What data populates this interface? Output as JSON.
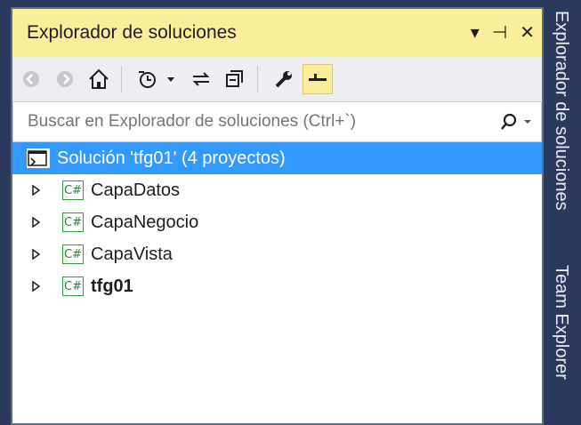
{
  "panel": {
    "title": "Explorador de soluciones",
    "window_buttons": {
      "dropdown": "▾",
      "pin": "⊣",
      "close": "✕"
    }
  },
  "toolbar": {
    "icons": [
      "back-icon",
      "forward-icon",
      "home-icon",
      "history-icon",
      "sync-icon",
      "collapse-all-icon",
      "properties-icon",
      "pin-active-icon"
    ]
  },
  "search": {
    "placeholder": "Buscar en Explorador de soluciones (Ctrl+`)",
    "icon": "search-icon"
  },
  "tree": {
    "solution_label": "Solución 'tfg01'  (4 proyectos)",
    "projects": [
      {
        "label": "CapaDatos",
        "bold": false
      },
      {
        "label": "CapaNegocio",
        "bold": false
      },
      {
        "label": "CapaVista",
        "bold": false
      },
      {
        "label": "tfg01",
        "bold": true
      }
    ],
    "project_icon_text": "C#"
  },
  "side_tabs": [
    "Explorador de soluciones",
    "Team Explorer"
  ],
  "colors": {
    "title_bg": "#fbee9a",
    "selected": "#3399ff",
    "frame": "#2b3a5c"
  }
}
